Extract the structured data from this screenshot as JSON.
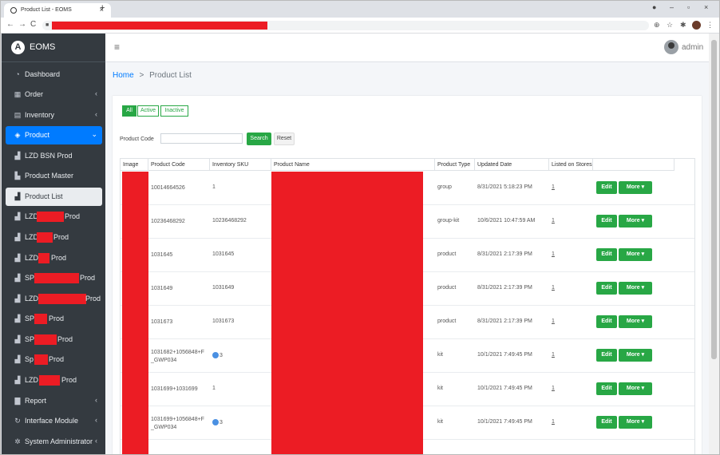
{
  "browser": {
    "tab_title": "Product List - EOMS",
    "tab_close": "×",
    "new_tab": "+",
    "win_min": "–",
    "win_max": "▫",
    "win_close": "×",
    "back": "←",
    "forward": "→",
    "reload": "C"
  },
  "sidebar": {
    "brand": "EOMS",
    "logo_letter": "A",
    "items": [
      {
        "label": "Dashboard",
        "icon": "dashboard-icon"
      },
      {
        "label": "Order",
        "icon": "cart-icon",
        "chevron": "‹"
      },
      {
        "label": "Inventory",
        "icon": "inventory-icon",
        "chevron": "‹"
      },
      {
        "label": "Product",
        "icon": "product-icon",
        "chevron": "⌄"
      },
      {
        "label": "LZD BSN Prod",
        "icon": "boxes-icon"
      },
      {
        "label": "Product Master",
        "icon": "master-icon"
      },
      {
        "label": "Product List",
        "icon": "boxes-icon"
      },
      {
        "label": "LZD",
        "suffix": "Prod",
        "icon": "boxes-icon"
      },
      {
        "label": "LZD",
        "suffix": "Prod",
        "icon": "boxes-icon"
      },
      {
        "label": "LZD",
        "suffix": "Prod",
        "icon": "boxes-icon"
      },
      {
        "label": "SP",
        "suffix": "Prod",
        "icon": "boxes-icon"
      },
      {
        "label": "LZD",
        "suffix": "Prod",
        "icon": "boxes-icon"
      },
      {
        "label": "SP",
        "suffix": "Prod",
        "icon": "boxes-icon"
      },
      {
        "label": "SP",
        "suffix": "Prod",
        "icon": "boxes-icon"
      },
      {
        "label": "Sp",
        "suffix": "Prod",
        "icon": "boxes-icon"
      },
      {
        "label": "LZD",
        "suffix": "Prod",
        "icon": "boxes-icon"
      },
      {
        "label": "Report",
        "icon": "report-icon",
        "chevron": "‹"
      },
      {
        "label": "Interface Module",
        "icon": "sync-icon",
        "chevron": "‹"
      },
      {
        "label": "System Administrator",
        "icon": "cogs-icon",
        "chevron": "‹"
      }
    ]
  },
  "header": {
    "menu_glyph": "≡",
    "user": "admin"
  },
  "breadcrumb": {
    "home": "Home",
    "separator": ">",
    "current": "Product List"
  },
  "filters": {
    "all": "All",
    "active": "Active",
    "inactive": "Inactive"
  },
  "search": {
    "label": "Product Code",
    "value": "",
    "search_button": "Search",
    "reset_button": "Reset"
  },
  "table": {
    "columns": [
      "Image",
      "Product Code",
      "Inventory SKU",
      "Product Name",
      "Product Type",
      "Updated Date",
      "Listed on Stores",
      ""
    ],
    "edit_label": "Edit",
    "more_label": "More ▾",
    "rows": [
      {
        "code": "10014664526",
        "sku": "1",
        "sku_badge": false,
        "type": "group",
        "updated": "8/31/2021 5:18:23 PM",
        "listed": "1"
      },
      {
        "code": "10236468292",
        "sku": "10236468292",
        "sku_badge": false,
        "type": "group-kit",
        "updated": "10/6/2021 10:47:59 AM",
        "listed": "1"
      },
      {
        "code": "1031645",
        "sku": "1031645",
        "sku_badge": false,
        "type": "product",
        "updated": "8/31/2021 2:17:39 PM",
        "listed": "1"
      },
      {
        "code": "1031649",
        "sku": "1031649",
        "sku_badge": false,
        "type": "product",
        "updated": "8/31/2021 2:17:39 PM",
        "listed": "1"
      },
      {
        "code": "1031673",
        "sku": "1031673",
        "sku_badge": false,
        "type": "product",
        "updated": "8/31/2021 2:17:39 PM",
        "listed": "1"
      },
      {
        "code": "1031682+1056848+F_GWP034",
        "sku": "3",
        "sku_badge": true,
        "type": "kit",
        "updated": "10/1/2021 7:49:45 PM",
        "listed": "1"
      },
      {
        "code": "1031699+1031699",
        "sku": "1",
        "sku_badge": false,
        "type": "kit",
        "updated": "10/1/2021 7:49:45 PM",
        "listed": "1"
      },
      {
        "code": "1031699+1056848+F_GWP034",
        "sku": "3",
        "sku_badge": true,
        "type": "kit",
        "updated": "10/1/2021 7:49:45 PM",
        "listed": "1"
      }
    ]
  },
  "colors": {
    "sidebar_bg": "#343a40",
    "active_nav": "#007bff",
    "success": "#28a745",
    "redaction": "#ec1c24"
  }
}
